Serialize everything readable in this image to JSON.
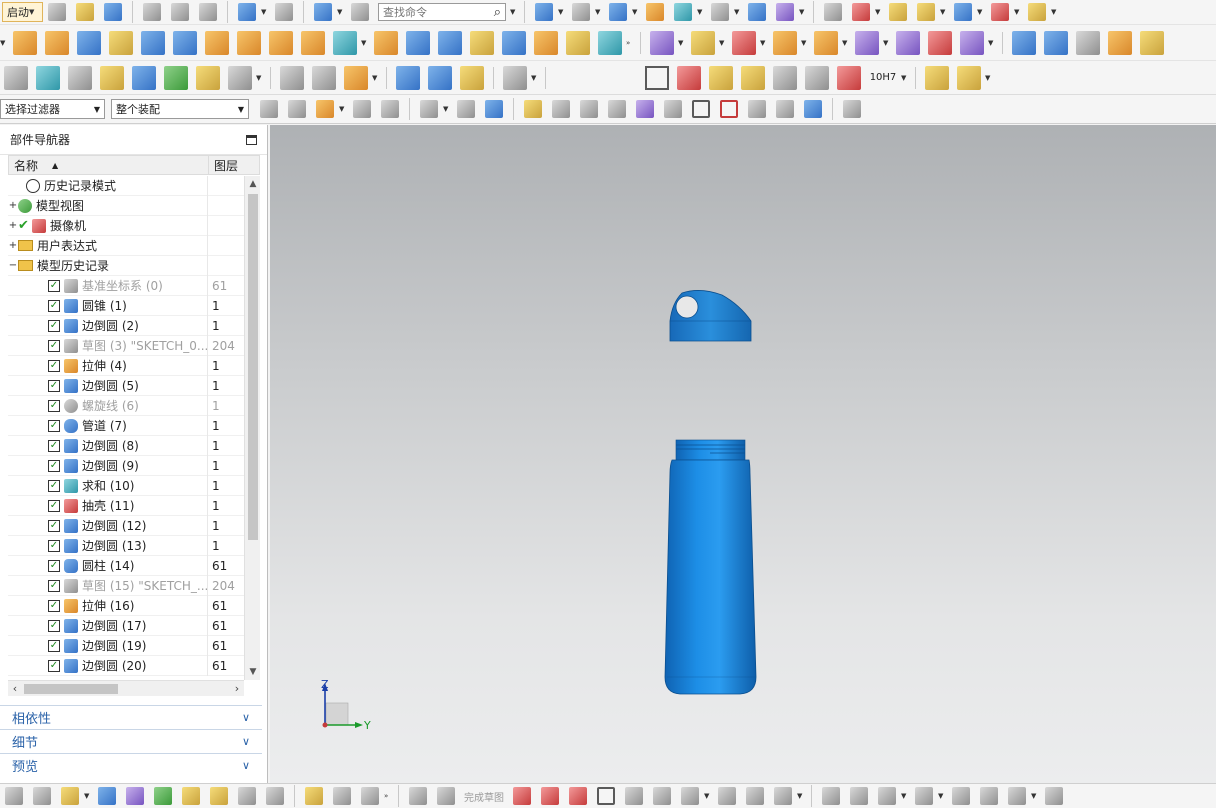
{
  "toolbar": {
    "start_label": "启动",
    "search_placeholder": "查找命令",
    "select_filter_label": "选择过滤器",
    "assembly_scope_label": "整个装配",
    "row3_fit_label": "10H7"
  },
  "navigator": {
    "title": "部件导航器",
    "col_name": "名称",
    "col_layer": "图层",
    "rows": [
      {
        "label": "历史记录模式",
        "layer": "",
        "icon": "clock-icon"
      },
      {
        "label": "模型视图",
        "layer": "",
        "icon": "model-views-icon"
      },
      {
        "label": "摄像机",
        "layer": "",
        "icon": "camera-icon"
      },
      {
        "label": "用户表达式",
        "layer": "",
        "icon": "folder-icon"
      },
      {
        "label": "模型历史记录",
        "layer": "",
        "icon": "folder-open-icon"
      },
      {
        "label": "基准坐标系 (0)",
        "layer": "61",
        "icon": "datum-csys-icon"
      },
      {
        "label": "圆锥 (1)",
        "layer": "1",
        "icon": "cone-icon"
      },
      {
        "label": "边倒圆 (2)",
        "layer": "1",
        "icon": "edge-blend-icon"
      },
      {
        "label": "草图 (3) \"SKETCH_0...",
        "layer": "204",
        "icon": "sketch-icon"
      },
      {
        "label": "拉伸 (4)",
        "layer": "1",
        "icon": "extrude-icon"
      },
      {
        "label": "边倒圆 (5)",
        "layer": "1",
        "icon": "edge-blend-icon"
      },
      {
        "label": "螺旋线 (6)",
        "layer": "1",
        "icon": "helix-icon"
      },
      {
        "label": "管道 (7)",
        "layer": "1",
        "icon": "tube-icon"
      },
      {
        "label": "边倒圆 (8)",
        "layer": "1",
        "icon": "edge-blend-icon"
      },
      {
        "label": "边倒圆 (9)",
        "layer": "1",
        "icon": "edge-blend-icon"
      },
      {
        "label": "求和 (10)",
        "layer": "1",
        "icon": "unite-icon"
      },
      {
        "label": "抽壳 (11)",
        "layer": "1",
        "icon": "shell-icon"
      },
      {
        "label": "边倒圆 (12)",
        "layer": "1",
        "icon": "edge-blend-icon"
      },
      {
        "label": "边倒圆 (13)",
        "layer": "1",
        "icon": "edge-blend-icon"
      },
      {
        "label": "圆柱 (14)",
        "layer": "61",
        "icon": "cylinder-icon"
      },
      {
        "label": "草图 (15) \"SKETCH_...",
        "layer": "204",
        "icon": "sketch-icon"
      },
      {
        "label": "拉伸 (16)",
        "layer": "61",
        "icon": "extrude-icon"
      },
      {
        "label": "边倒圆 (17)",
        "layer": "61",
        "icon": "edge-blend-icon"
      },
      {
        "label": "边倒圆 (19)",
        "layer": "61",
        "icon": "edge-blend-icon"
      },
      {
        "label": "边倒圆 (20)",
        "layer": "61",
        "icon": "edge-blend-icon"
      }
    ]
  },
  "panels": {
    "dependencies": "相依性",
    "details": "细节",
    "preview": "预览"
  },
  "viewport": {
    "triad_z": "Z",
    "triad_y": "Y",
    "model_color": "#1a86dc"
  },
  "bottom_toolbar": {
    "finish_sketch_label": "完成草图"
  }
}
